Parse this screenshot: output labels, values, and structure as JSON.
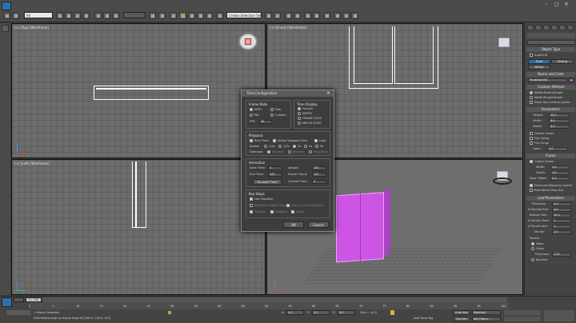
{
  "toolbar": {
    "selection_filter": "All",
    "create_selection_set": "Create Selection Set",
    "window_controls": [
      "-",
      "□",
      "×"
    ]
  },
  "viewports": {
    "top": "[+] [Top] [Wireframe]",
    "front": "[+] [Front] [Wireframe]",
    "left": "[+] [Left] [Wireframe]"
  },
  "command_panel": {
    "object_type": "Object Type",
    "autogrid": "AutoGrid",
    "buttons": [
      "Pivot",
      "Sliding",
      "BiFold"
    ],
    "name_and_color": "Name and Color",
    "name_value": "PivotDoor001",
    "creation_method": "Creation Method",
    "creation_options": [
      "Width/Depth/Height",
      "Width/Height/Depth",
      "Allow Non-vertical Jambs"
    ],
    "parameters": "Parameters",
    "params": [
      {
        "label": "Height:",
        "value": "22.0"
      },
      {
        "label": "Width:",
        "value": "8.0"
      },
      {
        "label": "Depth:",
        "value": "0.0"
      }
    ],
    "checks": [
      "Double Doors",
      "Flip Swing",
      "Flip Hinge"
    ],
    "open": {
      "label": "Open:",
      "value": "0.0"
    },
    "frame": "Frame",
    "create_frame": "Create Frame",
    "frame_params": [
      {
        "label": "Width:",
        "value": "2.0"
      },
      {
        "label": "Depth:",
        "value": "1.0"
      },
      {
        "label": "Door Offset:",
        "value": "0.0"
      }
    ],
    "mapping": [
      "Generate Mapping Coords",
      "Real-World Map Size"
    ],
    "leaf_parameters": "Leaf Parameters",
    "leaf_params": [
      {
        "label": "Thickness:",
        "value": "2.0"
      },
      {
        "label": "Stiles/Top Rail:",
        "value": "4.0"
      },
      {
        "label": "Bottom Rail:",
        "value": "12.0"
      },
      {
        "label": "# Panels Horiz:",
        "value": "1"
      },
      {
        "label": "# Panels Vert:",
        "value": "1"
      },
      {
        "label": "Muntin:",
        "value": "2.0"
      }
    ],
    "panels": "Panels:",
    "panel_options": [
      "None",
      "Glass"
    ],
    "glass_thickness": {
      "label": "Thickness:",
      "value": "0.25"
    },
    "beveled": "Beveled"
  },
  "dialog": {
    "title": "Time Configuration",
    "frame_rate": {
      "title": "Frame Rate",
      "options": [
        "NTSC",
        "PAL",
        "Film",
        "Custom"
      ],
      "fps_label": "FPS:",
      "fps_value": "30"
    },
    "time_display": {
      "title": "Time Display",
      "options": [
        "Frames",
        "SMPTE",
        "FRAME:TICKS",
        "MM:SS:TICKS"
      ]
    },
    "playback": {
      "title": "Playback",
      "real_time": "Real Time",
      "active_viewport": "Active Viewport Only",
      "loop": "Loop",
      "speed_label": "Speed:",
      "speeds": [
        "1/4x",
        "1/2x",
        "1x",
        "2x",
        "4x"
      ],
      "direction_label": "Direction:",
      "directions": [
        "Forward",
        "Reverse",
        "Ping-Pong"
      ]
    },
    "animation": {
      "title": "Animation",
      "start_label": "Start Time:",
      "start_value": "0",
      "end_label": "End Time:",
      "end_value": "100",
      "length_label": "Length:",
      "length_value": "100",
      "frame_count_label": "Frame Count:",
      "frame_count_value": "101",
      "rescale": "Re-scale Time",
      "current_label": "Current Time:",
      "current_value": "0"
    },
    "key_steps": {
      "title": "Key Steps",
      "use_trackbar": "Use TrackBar",
      "selected_only": "Selected Objects Only",
      "use_current": "Use Current Transform",
      "position": "Position",
      "rotation": "Rotation",
      "scale": "Scale"
    },
    "ok": "OK",
    "cancel": "Cancel"
  },
  "timeline": {
    "frame_indicator": "0 / 100",
    "ticks": [
      "0",
      "5",
      "10",
      "15",
      "20",
      "25",
      "30",
      "35",
      "40",
      "45",
      "50",
      "55",
      "60",
      "65",
      "70",
      "75",
      "80",
      "85",
      "90",
      "95",
      "100"
    ]
  },
  "status": {
    "objects_selected": "1 Object Selected",
    "prompt": "Grid Points snap on Scene Root at [100.0, 120.0, 0.0]",
    "x_label": "X:",
    "x_value": "0.0",
    "y_label": "Y:",
    "y_value": "0.0",
    "z_label": "Z:",
    "z_value": "0.0",
    "grid": "Grid = 10.0",
    "auto_key": "Auto Key",
    "selected": "Selected",
    "set_key": "Set Key",
    "key_filters": "Key Filters...",
    "add_time_tag": "Add Time Tag"
  },
  "colors": {
    "object_magenta": "#cc55e6",
    "selection_yellow": "#f0c040"
  }
}
